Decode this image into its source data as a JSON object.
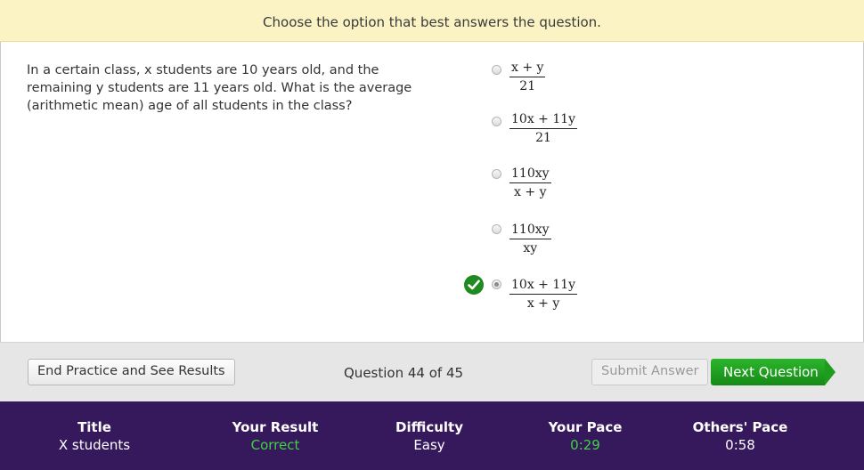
{
  "instruction": "Choose the option that best answers the question.",
  "question": "In a certain class, x students are 10 years old, and the remaining y students are 11 years old. What is the average (arithmetic mean) age of all students in the class?",
  "options": [
    {
      "num": "x + y",
      "den": "21"
    },
    {
      "num": "10x + 11y",
      "den": "21"
    },
    {
      "num": "110xy",
      "den": "x + y"
    },
    {
      "num": "110xy",
      "den": "xy"
    },
    {
      "num": "10x + 11y",
      "den": "x + y"
    }
  ],
  "selected_option": 5,
  "correct_option": 5,
  "toolbar": {
    "end_label": "End Practice and See Results",
    "counter": "Question 44 of 45",
    "submit_label": "Submit Answer",
    "next_label": "Next Question"
  },
  "stats": {
    "title_label": "Title",
    "title_value": "X students",
    "result_label": "Your Result",
    "result_value": "Correct",
    "difficulty_label": "Difficulty",
    "difficulty_value": "Easy",
    "pace_label": "Your Pace",
    "pace_value": "0:29",
    "others_label": "Others' Pace",
    "others_value": "0:58"
  },
  "colors": {
    "instruction_bg": "#fbf3c3",
    "stats_bg": "#36195c",
    "accent_green": "#1f8a1f",
    "result_green": "#3ed43e"
  }
}
